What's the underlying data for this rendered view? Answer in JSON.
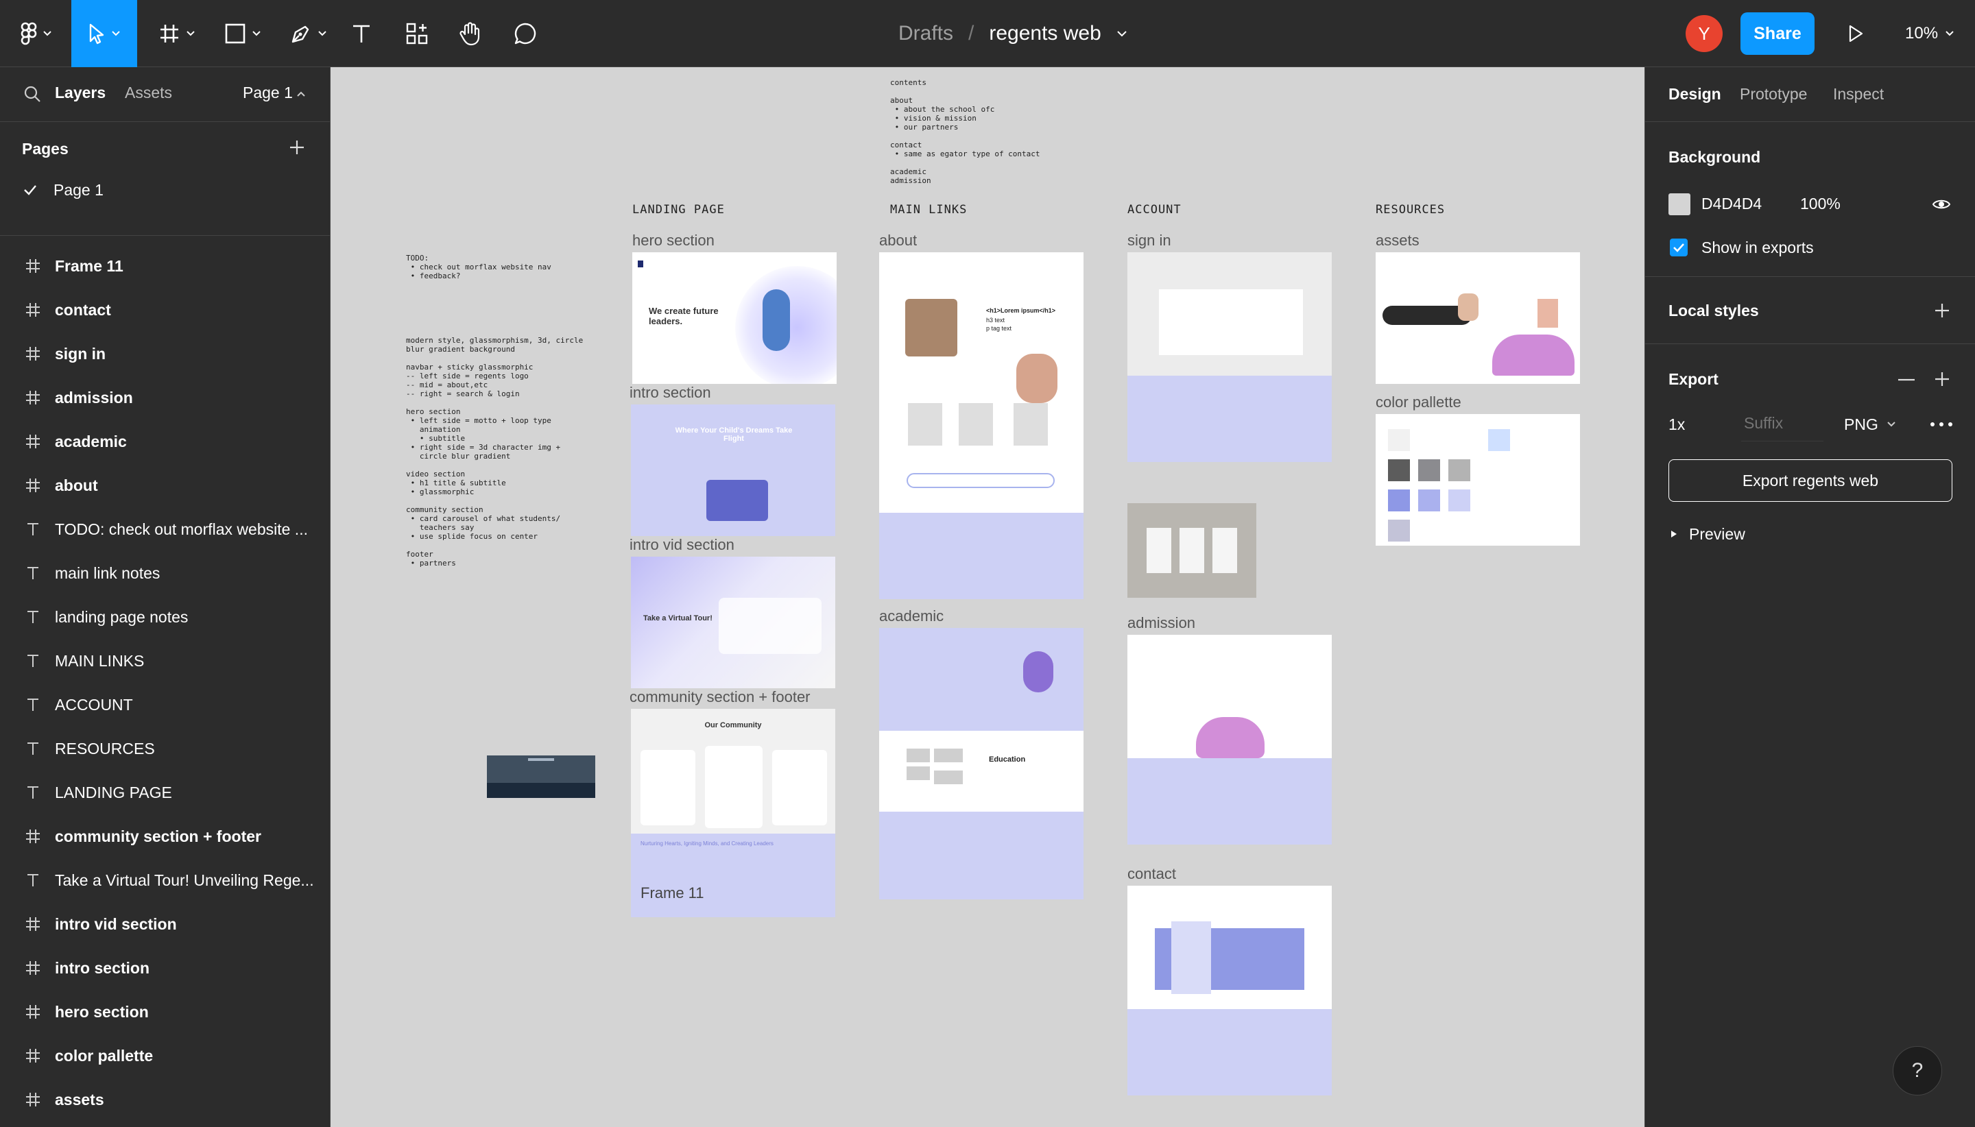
{
  "toolbar": {
    "breadcrumb_drafts": "Drafts",
    "breadcrumb_sep": "/",
    "file_name": "regents web",
    "avatar_initial": "Y",
    "share_label": "Share",
    "zoom": "10%"
  },
  "left": {
    "tab_layers": "Layers",
    "tab_assets": "Assets",
    "page_selector": "Page 1",
    "pages_heading": "Pages",
    "current_page": "Page 1",
    "layers": [
      {
        "label": "Frame 11",
        "type": "frame",
        "bold": true
      },
      {
        "label": "contact",
        "type": "frame",
        "bold": true
      },
      {
        "label": "sign in",
        "type": "frame",
        "bold": true
      },
      {
        "label": "admission",
        "type": "frame",
        "bold": true
      },
      {
        "label": "academic",
        "type": "frame",
        "bold": true
      },
      {
        "label": "about",
        "type": "frame",
        "bold": true
      },
      {
        "label": "TODO: check out morflax website ...",
        "type": "text",
        "bold": false
      },
      {
        "label": "main link notes",
        "type": "text",
        "bold": false
      },
      {
        "label": "landing page notes",
        "type": "text",
        "bold": false
      },
      {
        "label": "MAIN LINKS",
        "type": "text",
        "bold": false
      },
      {
        "label": "ACCOUNT",
        "type": "text",
        "bold": false
      },
      {
        "label": "RESOURCES",
        "type": "text",
        "bold": false
      },
      {
        "label": "LANDING PAGE",
        "type": "text",
        "bold": false
      },
      {
        "label": "community section + footer",
        "type": "frame",
        "bold": true
      },
      {
        "label": "Take a Virtual Tour! Unveiling Rege...",
        "type": "text",
        "bold": false
      },
      {
        "label": "intro vid section",
        "type": "frame",
        "bold": true
      },
      {
        "label": "intro section",
        "type": "frame",
        "bold": true
      },
      {
        "label": "hero section",
        "type": "frame",
        "bold": true
      },
      {
        "label": "color pallette",
        "type": "frame",
        "bold": true
      },
      {
        "label": "assets",
        "type": "frame",
        "bold": true
      }
    ]
  },
  "canvas": {
    "background": "#D4D4D4",
    "groups": {
      "landing": "LANDING PAGE",
      "main_links": "MAIN LINKS",
      "account": "ACCOUNT",
      "resources": "RESOURCES"
    },
    "frames": {
      "hero": "hero section",
      "intro": "intro section",
      "intro_vid": "intro vid section",
      "community": "community section + footer",
      "frame11": "Frame 11",
      "about": "about",
      "academic": "academic",
      "sign_in": "sign in",
      "admission": "admission",
      "contact": "contact",
      "assets": "assets",
      "color_pallette": "color pallette"
    },
    "todo_note": "TODO:\n • check out morflax website nav\n • feedback?",
    "landing_notes": "modern style, glassmorphism, 3d, circle\nblur gradient background\n\nnavbar + sticky glassmorphic\n-- left side = regents logo\n-- mid = about,etc\n-- right = search & login\n\nhero section\n • left side = motto + loop type\n   animation\n   • subtitle\n • right side = 3d character img +\n   circle blur gradient\n\nvideo section\n • h1 title & subtitle\n • glassmorphic\n\ncommunity section\n • card carousel of what students/\n   teachers say\n • use splide focus on center\n\nfooter\n • partners",
    "main_link_notes": "contents\n\nabout\n • about the school ofc\n • vision & mission\n • our partners\n\ncontact\n • same as egator type of contact\n\nacademic\nadmission",
    "hero_text": "We create future leaders.",
    "intro_text": "Where Your Child's Dreams Take Flight",
    "vid_text": "Take a Virtual Tour!",
    "community_text": "Our Community",
    "about_h1": "<h1>Lorem ipsum</h1>",
    "about_h3": "h3 text",
    "about_p": "p tag text",
    "academic_title": "Education",
    "footer_text": "Nurturing Hearts, Igniting Minds, and Creating Leaders"
  },
  "right": {
    "tab_design": "Design",
    "tab_prototype": "Prototype",
    "tab_inspect": "Inspect",
    "background_heading": "Background",
    "bg_hex": "D4D4D4",
    "bg_opacity": "100%",
    "show_in_exports": "Show in exports",
    "local_styles": "Local styles",
    "export_heading": "Export",
    "export_scale": "1x",
    "export_suffix_placeholder": "Suffix",
    "export_format": "PNG",
    "export_button": "Export regents web",
    "preview": "Preview"
  },
  "colors": {
    "accent": "#0d99ff",
    "avatar": "#e8432f",
    "lavender": "#cdd0f5",
    "palette": [
      "#f1f1f1",
      "#cfe0ff",
      "#5c5c5c",
      "#8b8b8f",
      "#b3b3b3",
      "#8e98e6",
      "#aab1ee",
      "#cdd1f6",
      "#c3c3d8"
    ]
  },
  "help": "?"
}
